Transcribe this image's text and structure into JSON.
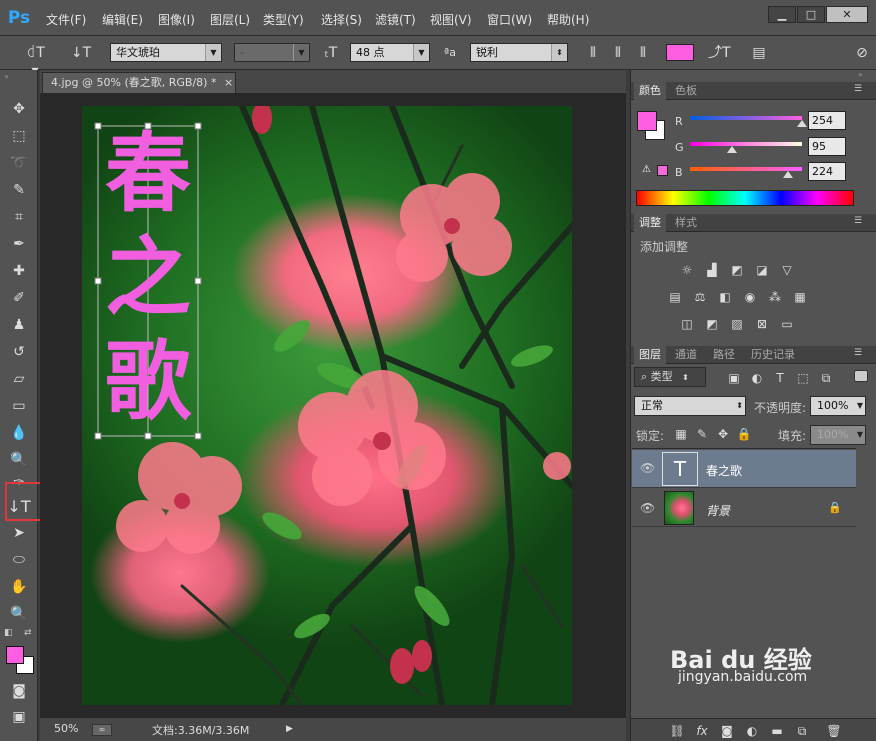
{
  "app": {
    "logo": "Ps"
  },
  "menu": [
    "文件(F)",
    "编辑(E)",
    "图像(I)",
    "图层(L)",
    "类型(Y)",
    "选择(S)",
    "滤镜(T)",
    "视图(V)",
    "窗口(W)",
    "帮助(H)"
  ],
  "window_controls": {
    "minimize": "▁",
    "maximize": "□",
    "close": "✕"
  },
  "options": {
    "font_family": "华文琥珀",
    "font_style": "-",
    "font_size": "48 点",
    "antialias": "锐利",
    "text_color": "#fe5fe0",
    "aa_label": "ªa"
  },
  "document": {
    "tab_title": "4.jpg @ 50% (春之歌, RGB/8) *",
    "close": "×",
    "text_layer_content": [
      "春",
      "之",
      "歌"
    ],
    "text_color": "#f25ee0"
  },
  "status": {
    "zoom": "50%",
    "doc_info": "文档:3.36M/3.36M"
  },
  "color_panel": {
    "tabs": [
      "颜色",
      "色板"
    ],
    "fg": "#fe5fe0",
    "channels": [
      {
        "label": "R",
        "value": "254",
        "fraction": 0.996
      },
      {
        "label": "G",
        "value": "95",
        "fraction": 0.373
      },
      {
        "label": "B",
        "value": "224",
        "fraction": 0.878
      }
    ]
  },
  "adjustments_panel": {
    "tabs": [
      "调整",
      "样式"
    ],
    "title": "添加调整"
  },
  "layers_panel": {
    "tabs": [
      "图层",
      "通道",
      "路径",
      "历史记录"
    ],
    "filter": "类型",
    "blend_mode": "正常",
    "opacity_label": "不透明度:",
    "opacity_value": "100%",
    "lock_label": "锁定:",
    "fill_label": "填充:",
    "fill_value": "100%",
    "layers": [
      {
        "name": "春之歌",
        "type": "text",
        "selected": true
      },
      {
        "name": "背景",
        "type": "image",
        "selected": false,
        "locked": true
      }
    ]
  },
  "watermark": {
    "brand": "Bai du 经验",
    "url": "jingyan.baidu.com"
  }
}
